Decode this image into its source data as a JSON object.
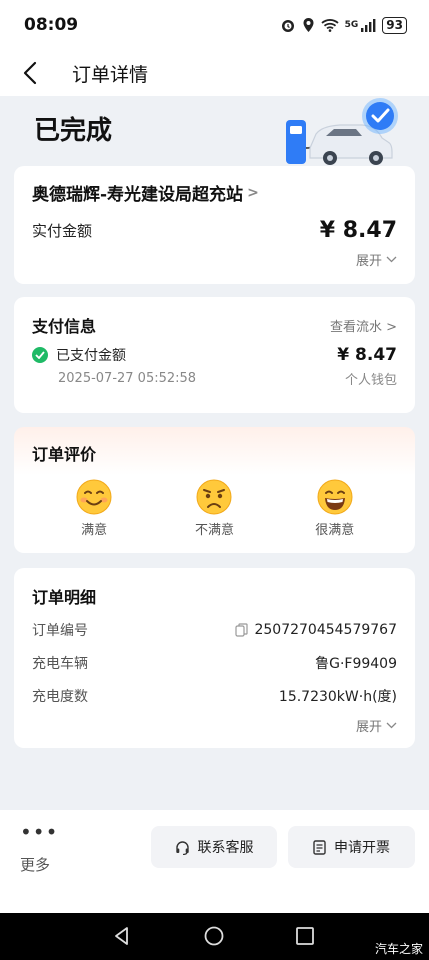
{
  "status_bar": {
    "time": "08:09",
    "network": "5G",
    "battery": "93"
  },
  "nav": {
    "title": "订单详情"
  },
  "hero": {
    "status": "已完成"
  },
  "station_card": {
    "station": "奥德瑞辉-寿光建设局超充站",
    "amount_label": "实付金额",
    "amount": "¥ 8.47",
    "expand": "展开"
  },
  "payment_card": {
    "title": "支付信息",
    "link": "查看流水",
    "paid_label": "已支付金额",
    "paid_amount": "¥ 8.47",
    "paid_time": "2025-07-27 05:52:58",
    "method": "个人钱包"
  },
  "rating_card": {
    "title": "订单评价",
    "options": [
      {
        "label": "满意"
      },
      {
        "label": "不满意"
      },
      {
        "label": "很满意"
      }
    ]
  },
  "detail_card": {
    "title": "订单明细",
    "order_no_label": "订单编号",
    "order_no": "2507270454579767",
    "vehicle_label": "充电车辆",
    "vehicle": "鲁G·F99409",
    "energy_label": "充电度数",
    "energy": "15.7230kW·h(度)",
    "expand": "展开"
  },
  "bottom_bar": {
    "more": "更多",
    "service": "联系客服",
    "invoice": "申请开票"
  },
  "watermark": "汽车之家",
  "colors": {
    "success": "#1fba66",
    "page_bg": "#eef1f5"
  }
}
